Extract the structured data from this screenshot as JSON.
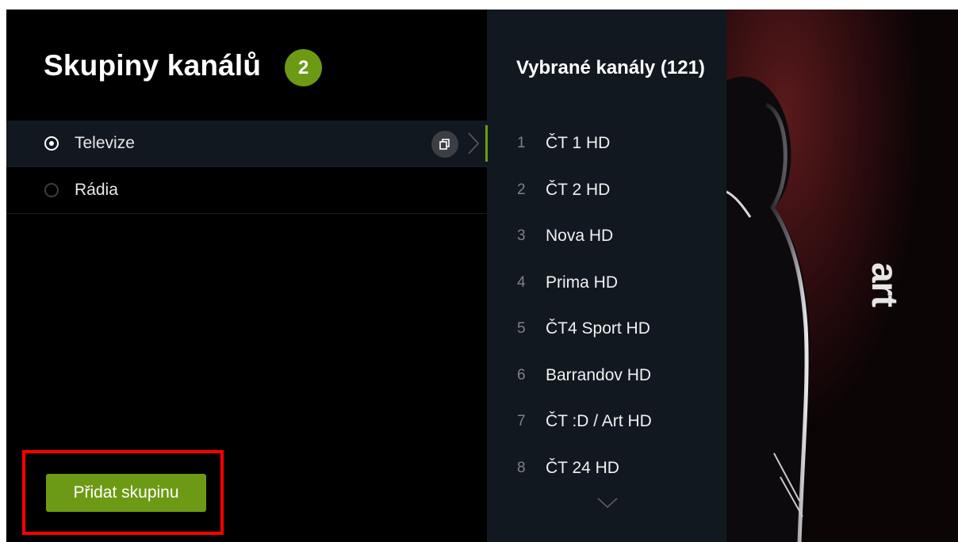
{
  "header": {
    "title": "Skupiny kanálů",
    "badge_count": "2"
  },
  "groups": [
    {
      "label": "Televize",
      "selected": true
    },
    {
      "label": "Rádia",
      "selected": false
    }
  ],
  "icons": {
    "copy": "copy-icon",
    "chevron": "chevron-right-icon",
    "scroll": "chevron-down-icon"
  },
  "actions": {
    "add_group_label": "Přidat skupinu"
  },
  "channels": {
    "title": "Vybrané kanály (121)",
    "items": [
      {
        "number": "1",
        "name": "ČT 1 HD"
      },
      {
        "number": "2",
        "name": "ČT 2 HD"
      },
      {
        "number": "3",
        "name": "Nova HD"
      },
      {
        "number": "4",
        "name": "Prima HD"
      },
      {
        "number": "5",
        "name": "ČT4 Sport HD"
      },
      {
        "number": "6",
        "name": "Barrandov HD"
      },
      {
        "number": "7",
        "name": "ČT :D / Art HD"
      },
      {
        "number": "8",
        "name": "ČT 24 HD"
      }
    ]
  },
  "preview": {
    "logo_text": "art"
  },
  "colors": {
    "accent": "#6d9a14",
    "highlight_border": "#ff0000",
    "panel": "#121820",
    "background": "#000000"
  }
}
